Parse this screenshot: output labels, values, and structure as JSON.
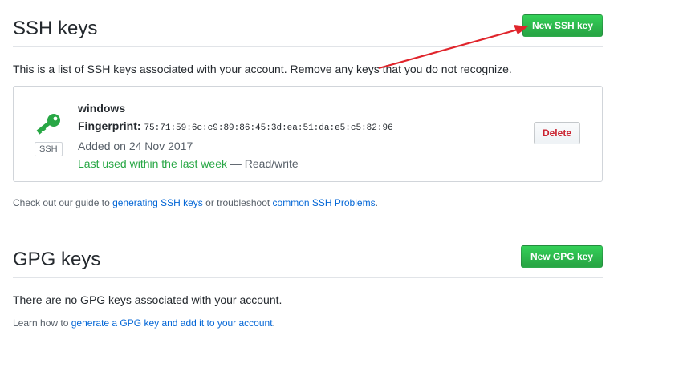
{
  "ssh": {
    "title": "SSH keys",
    "new_button": "New SSH key",
    "intro": "This is a list of SSH keys associated with your account. Remove any keys that you do not recognize.",
    "key": {
      "icon": "key-icon",
      "badge": "SSH",
      "name": "windows",
      "fingerprint_label": "Fingerprint:",
      "fingerprint": "75:71:59:6c:c9:89:86:45:3d:ea:51:da:e5:c5:82:96",
      "added": "Added on 24 Nov 2017",
      "last_used": "Last used within the last week",
      "access": "— Read/write",
      "delete_label": "Delete"
    },
    "help": {
      "prefix": "Check out our guide to ",
      "link1": "generating SSH keys",
      "middle": " or troubleshoot ",
      "link2": "common SSH Problems",
      "suffix": "."
    }
  },
  "gpg": {
    "title": "GPG keys",
    "new_button": "New GPG key",
    "empty": "There are no GPG keys associated with your account.",
    "help": {
      "prefix": "Learn how to ",
      "link": "generate a GPG key and add it to your account",
      "suffix": "."
    }
  },
  "colors": {
    "green": "#28a745",
    "link": "#0366d6",
    "danger": "#cb2431",
    "annotation_arrow": "#e0242b"
  }
}
